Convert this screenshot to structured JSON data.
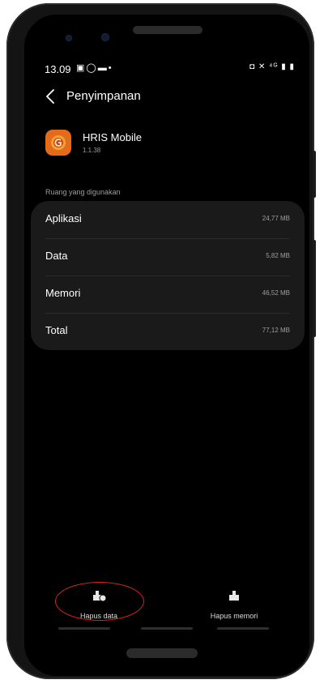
{
  "status_bar": {
    "time": "13.09",
    "left_icons": [
      "gallery-icon",
      "whatsapp-icon",
      "chat-icon",
      "dot-icon"
    ],
    "right_icons": [
      "alarm-icon",
      "mute-icon",
      "4g-icon",
      "signal-icon",
      "battery-icon"
    ]
  },
  "appbar": {
    "title": "Penyimpanan"
  },
  "app": {
    "name": "HRIS Mobile",
    "version": "1.1.38",
    "icon_color": "#e46b1a"
  },
  "storage": {
    "section_label": "Ruang yang digunakan",
    "rows": [
      {
        "label": "Aplikasi",
        "value": "24,77 MB"
      },
      {
        "label": "Data",
        "value": "5,82 MB"
      },
      {
        "label": "Memori",
        "value": "46,52 MB"
      },
      {
        "label": "Total",
        "value": "77,12 MB"
      }
    ]
  },
  "actions": {
    "clear_data": "Hapus data",
    "clear_cache": "Hapus memori"
  },
  "colors": {
    "highlight_ring": "#d9232a",
    "card_bg": "#1a1a1a",
    "screen_bg": "#000000"
  }
}
